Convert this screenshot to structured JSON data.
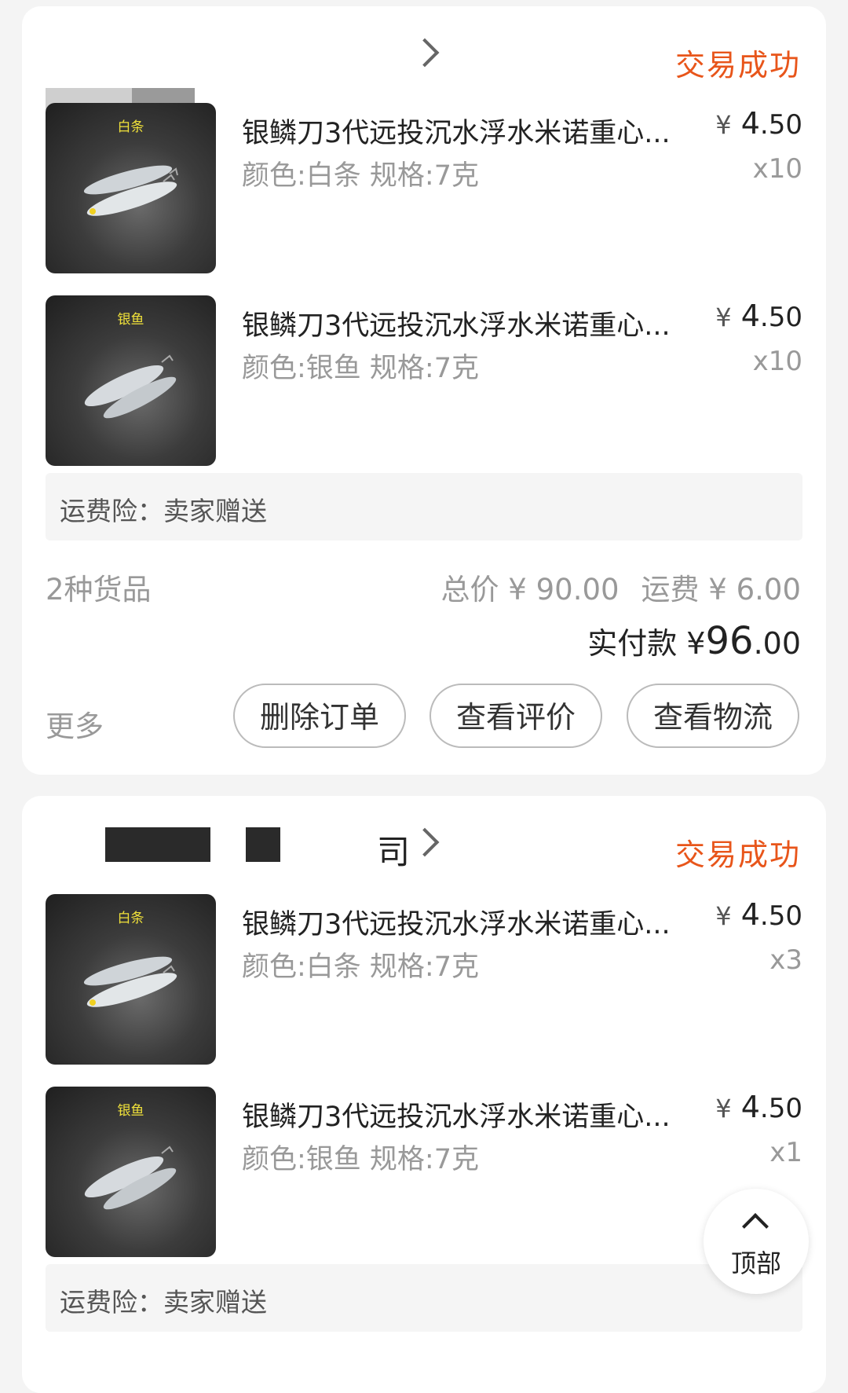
{
  "orders": [
    {
      "shop_name": "",
      "status": "交易成功",
      "items": [
        {
          "thumb_label": "白条",
          "title": "银鳞刀3代远投沉水浮水米诺重心...",
          "spec": "颜色:白条 规格:7克",
          "price_currency": "¥",
          "price_int": "4",
          "price_dec": ".50",
          "qty": "x10"
        },
        {
          "thumb_label": "银鱼",
          "title": "银鳞刀3代远投沉水浮水米诺重心...",
          "spec": "颜色:银鱼 规格:7克",
          "price_currency": "¥",
          "price_int": "4",
          "price_dec": ".50",
          "qty": "x10"
        }
      ],
      "insurance": "运费险：卖家赠送",
      "count": "2种货品",
      "total": "总价 ¥ 90.00",
      "shipping": "运费 ¥ 6.00",
      "paid_label": "实付款 ¥",
      "paid_int": "96",
      "paid_dec": ".00",
      "more": "更多",
      "buttons": [
        "删除订单",
        "查看评价",
        "查看物流"
      ]
    },
    {
      "shop_name": "司",
      "status": "交易成功",
      "items": [
        {
          "thumb_label": "白条",
          "title": "银鳞刀3代远投沉水浮水米诺重心...",
          "spec": "颜色:白条 规格:7克",
          "price_currency": "¥",
          "price_int": "4",
          "price_dec": ".50",
          "qty": "x3"
        },
        {
          "thumb_label": "银鱼",
          "title": "银鳞刀3代远投沉水浮水米诺重心...",
          "spec": "颜色:银鱼 规格:7克",
          "price_currency": "¥",
          "price_int": "4",
          "price_dec": ".50",
          "qty": "x1"
        }
      ],
      "insurance": "运费险：卖家赠送"
    }
  ],
  "top_button": {
    "label": "顶部",
    "icon": "chevron-up-icon"
  },
  "colors": {
    "status": "#e8551a",
    "background": "#f4f4f4",
    "card": "#ffffff"
  }
}
